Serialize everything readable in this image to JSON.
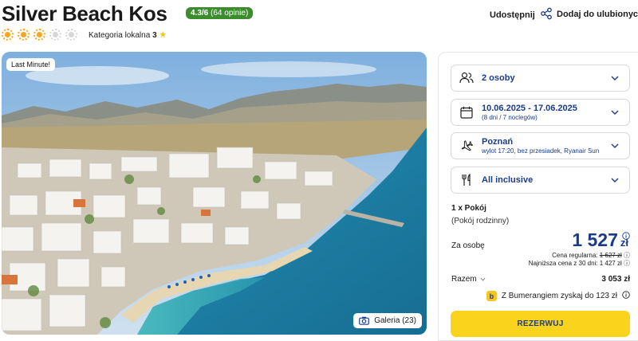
{
  "hotel": {
    "name": "Silver Beach Kos",
    "rating": "4.3/6",
    "rating_count": "(64 opinie)",
    "suns_filled": 3,
    "suns_total": 5,
    "category_label": "Kategoria lokalna",
    "category_value": "3"
  },
  "actions": {
    "share_label": "Udostępnij",
    "favorite_label": "Dodaj do ulubionych"
  },
  "photo": {
    "badge": "Last Minute!",
    "gallery_label": "Galeria (23)"
  },
  "booking": {
    "guests": "2 osoby",
    "dates": "10.06.2025 - 17.06.2025",
    "dates_sub": "(8 dni / 7 noclegów)",
    "departure_city": "Poznań",
    "flight_info": "wylot 17:20, bez przesiadek, Ryanair Sun",
    "board": "All inclusive",
    "room_count": "1 x Pokój",
    "room_type": "(Pokój rodzinny)",
    "per_person_label": "Za osobę",
    "price": "1 527",
    "currency": "zł",
    "regular_price_label": "Cena regularna:",
    "regular_price": "1 627 zł",
    "lowest_price_text": "Najniższa cena z 30 dni: 1 427 zł",
    "total_label": "Razem",
    "total": "3 053 zł",
    "boomerang_text": "Z Bumerangiem zyskaj do 123 zł",
    "reserve_label": "REZERWUJ"
  },
  "colors": {
    "accent_blue": "#1a3b8c",
    "rating_green": "#3c8c2e",
    "reserve_yellow": "#f9d31c",
    "sun_orange": "#f5a623"
  }
}
